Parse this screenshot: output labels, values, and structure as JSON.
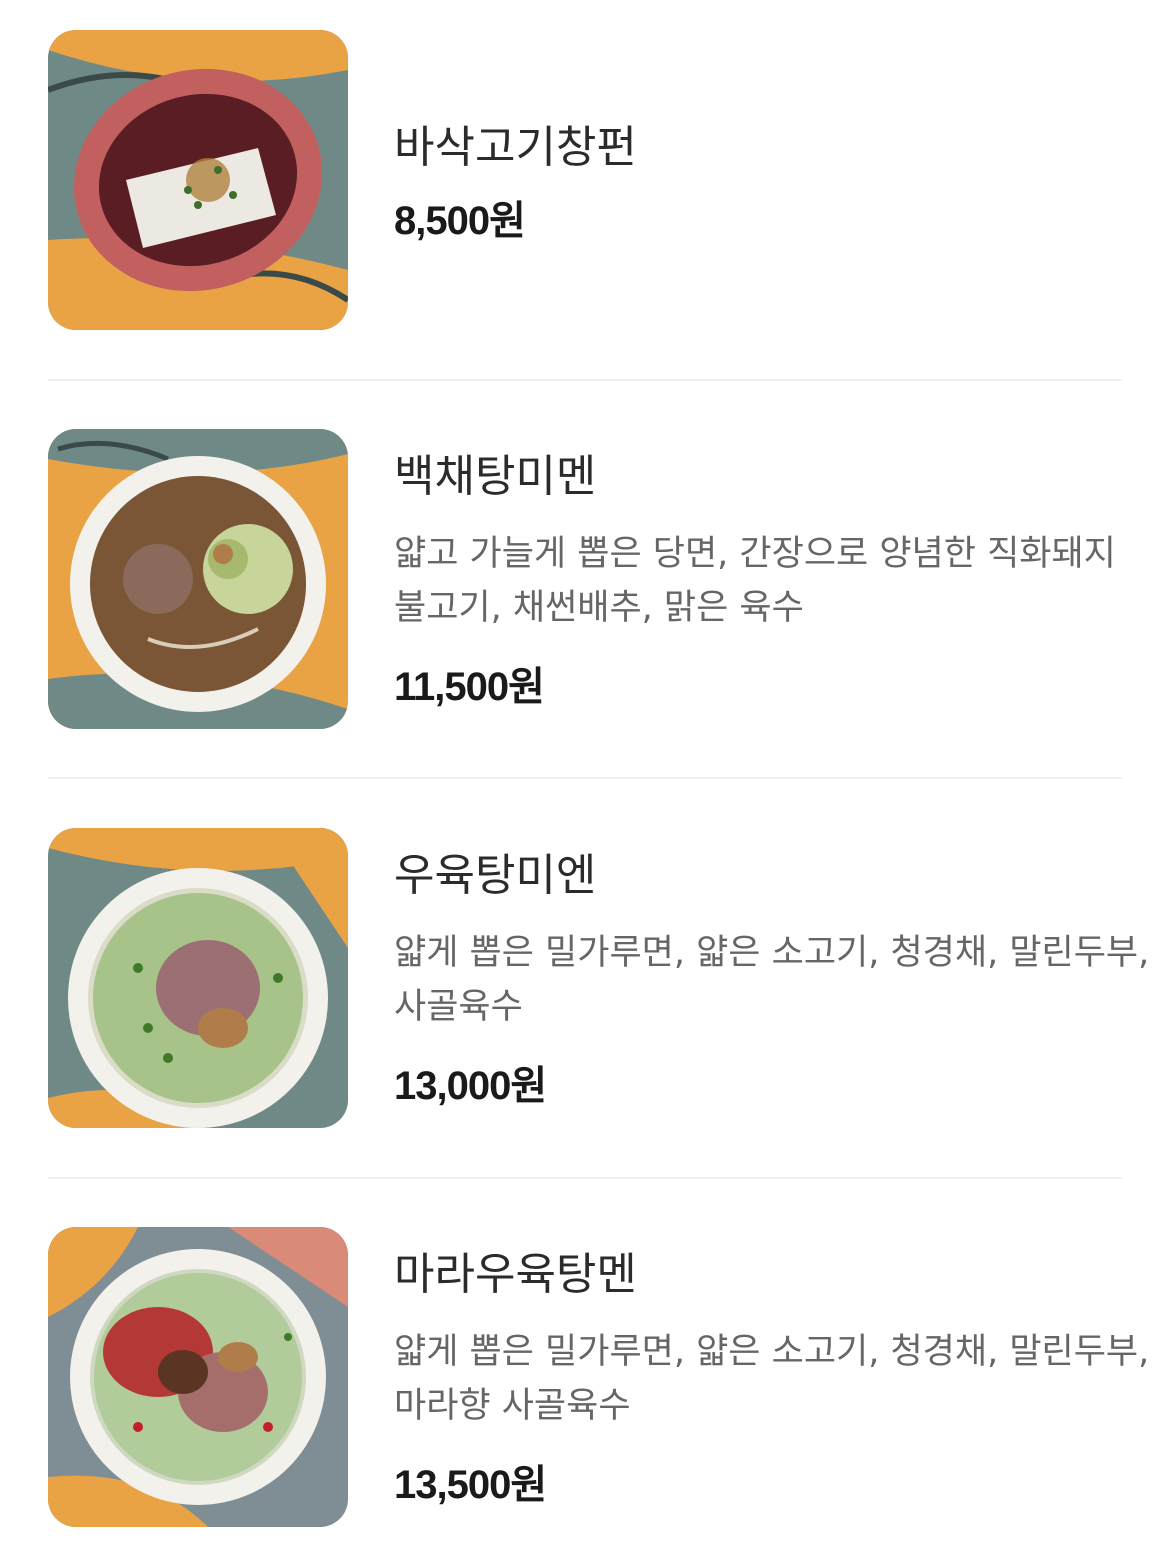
{
  "menu": {
    "items": [
      {
        "name": "바삭고기창펀",
        "description_lines": [],
        "price": "8,500원",
        "photo_icon": "rice-roll-plate-photo"
      },
      {
        "name": "백채탕미멘",
        "description_lines": [
          "얇고 가늘게 뽑은 당면, 간장으로 양념한 직화돼지",
          "불고기, 채썬배추, 맑은 육수"
        ],
        "price": "11,500원",
        "photo_icon": "noodle-soup-bowl-photo"
      },
      {
        "name": "우육탕미엔",
        "description_lines": [
          "얇게 뽑은 밀가루면, 얇은 소고기, 청경채, 말린두부,",
          "사골육수"
        ],
        "price": "13,000원",
        "photo_icon": "beef-noodle-soup-bowl-photo"
      },
      {
        "name": "마라우육탕멘",
        "description_lines": [
          "얇게 뽑은 밀가루면, 얇은 소고기, 청경채, 말린두부,",
          "마라향 사골육수"
        ],
        "price": "13,500원",
        "photo_icon": "mala-beef-noodle-soup-bowl-photo"
      }
    ]
  },
  "colors": {
    "tablecloth_orange": "#e9a244",
    "tablecloth_teal": "#6f8a86",
    "plate_red": "#c26060",
    "bowl_white": "#f3f1ec",
    "divider": "#f0f0f0"
  }
}
